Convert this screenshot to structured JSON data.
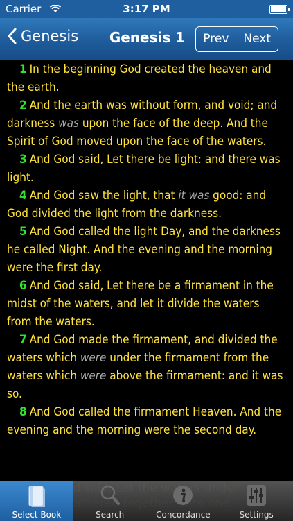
{
  "status": {
    "carrier": "Carrier",
    "time": "3:17 PM"
  },
  "nav": {
    "back_label": "Genesis",
    "title": "Genesis 1",
    "prev_label": "Prev",
    "next_label": "Next"
  },
  "verses": [
    {
      "num": "1",
      "parts": [
        {
          "t": "In the beginning God created the heaven and the earth."
        }
      ]
    },
    {
      "num": "2",
      "parts": [
        {
          "t": "And the earth was without form, and void; and darkness "
        },
        {
          "t": "was",
          "i": true
        },
        {
          "t": " upon the face of the deep. And the Spirit of God moved upon the face of the waters."
        }
      ]
    },
    {
      "num": "3",
      "parts": [
        {
          "t": "And God said, Let there be light: and there was light."
        }
      ]
    },
    {
      "num": "4",
      "parts": [
        {
          "t": "And God saw the light, that "
        },
        {
          "t": "it was",
          "i": true
        },
        {
          "t": " good: and God divided the light from the darkness."
        }
      ]
    },
    {
      "num": "5",
      "parts": [
        {
          "t": "And God called the light Day, and the darkness he called Night. And the evening and the morning were the first day."
        }
      ]
    },
    {
      "num": "6",
      "parts": [
        {
          "t": "And God said, Let there be a firmament in the midst of the waters, and let it divide the waters from the waters."
        }
      ]
    },
    {
      "num": "7",
      "parts": [
        {
          "t": "And God made the firmament, and divided the waters which "
        },
        {
          "t": "were",
          "i": true
        },
        {
          "t": " under the firmament from the waters which "
        },
        {
          "t": "were",
          "i": true
        },
        {
          "t": " above the firmament: and it was so."
        }
      ]
    },
    {
      "num": "8",
      "parts": [
        {
          "t": "And God called the firmament Heaven. And the evening and the morning were the second day."
        }
      ]
    }
  ],
  "ghost_lines": [
    "od said, Let the waters under",
    "gathered together unto one"
  ],
  "tabs": [
    {
      "label": "Select Book",
      "icon": "book-icon",
      "active": true
    },
    {
      "label": "Search",
      "icon": "magnifier-icon",
      "active": false
    },
    {
      "label": "Concordance",
      "icon": "info-icon",
      "active": false
    },
    {
      "label": "Settings",
      "icon": "sliders-icon",
      "active": false
    }
  ],
  "colors": {
    "navbar": "#1f5c9b",
    "verse_text": "#ffe23a",
    "verse_number": "#2ee62e",
    "italic_text": "#a9a9a9",
    "background": "#000000"
  }
}
